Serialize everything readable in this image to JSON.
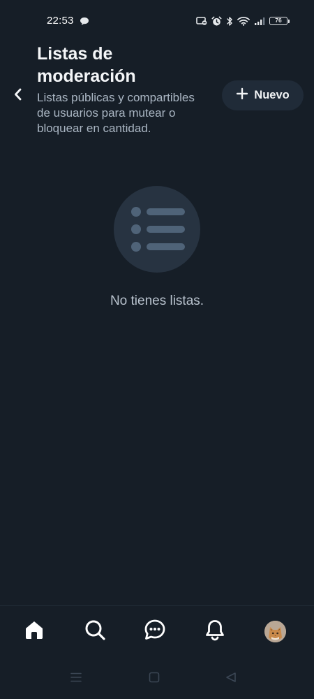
{
  "status_bar": {
    "time": "22:53",
    "battery": "76",
    "icons": [
      "chat-bubble-icon",
      "nfc-card-icon",
      "alarm-icon",
      "bluetooth-icon",
      "wifi-icon",
      "signal-icon",
      "battery-icon"
    ]
  },
  "header": {
    "title": "Listas de moderación",
    "subtitle": "Listas públicas y compartibles de usuarios para mutear o bloquear en cantidad.",
    "new_button_label": "Nuevo",
    "back_icon": "chevron-left-icon",
    "new_icon": "plus-icon"
  },
  "empty_state": {
    "icon": "list-icon",
    "message": "No tienes listas."
  },
  "bottom_nav": {
    "items": [
      "home-icon",
      "search-icon",
      "chat-icon",
      "bell-icon",
      "avatar"
    ]
  },
  "system_nav": {
    "items": [
      "menu-icon",
      "home-square-icon",
      "back-triangle-icon"
    ]
  },
  "colors": {
    "background": "#161e27",
    "surface": "#202b38",
    "empty_circle": "#273341",
    "empty_icon": "#4f6378",
    "text_primary": "#f1f3f5",
    "text_secondary": "#aab6c3"
  }
}
